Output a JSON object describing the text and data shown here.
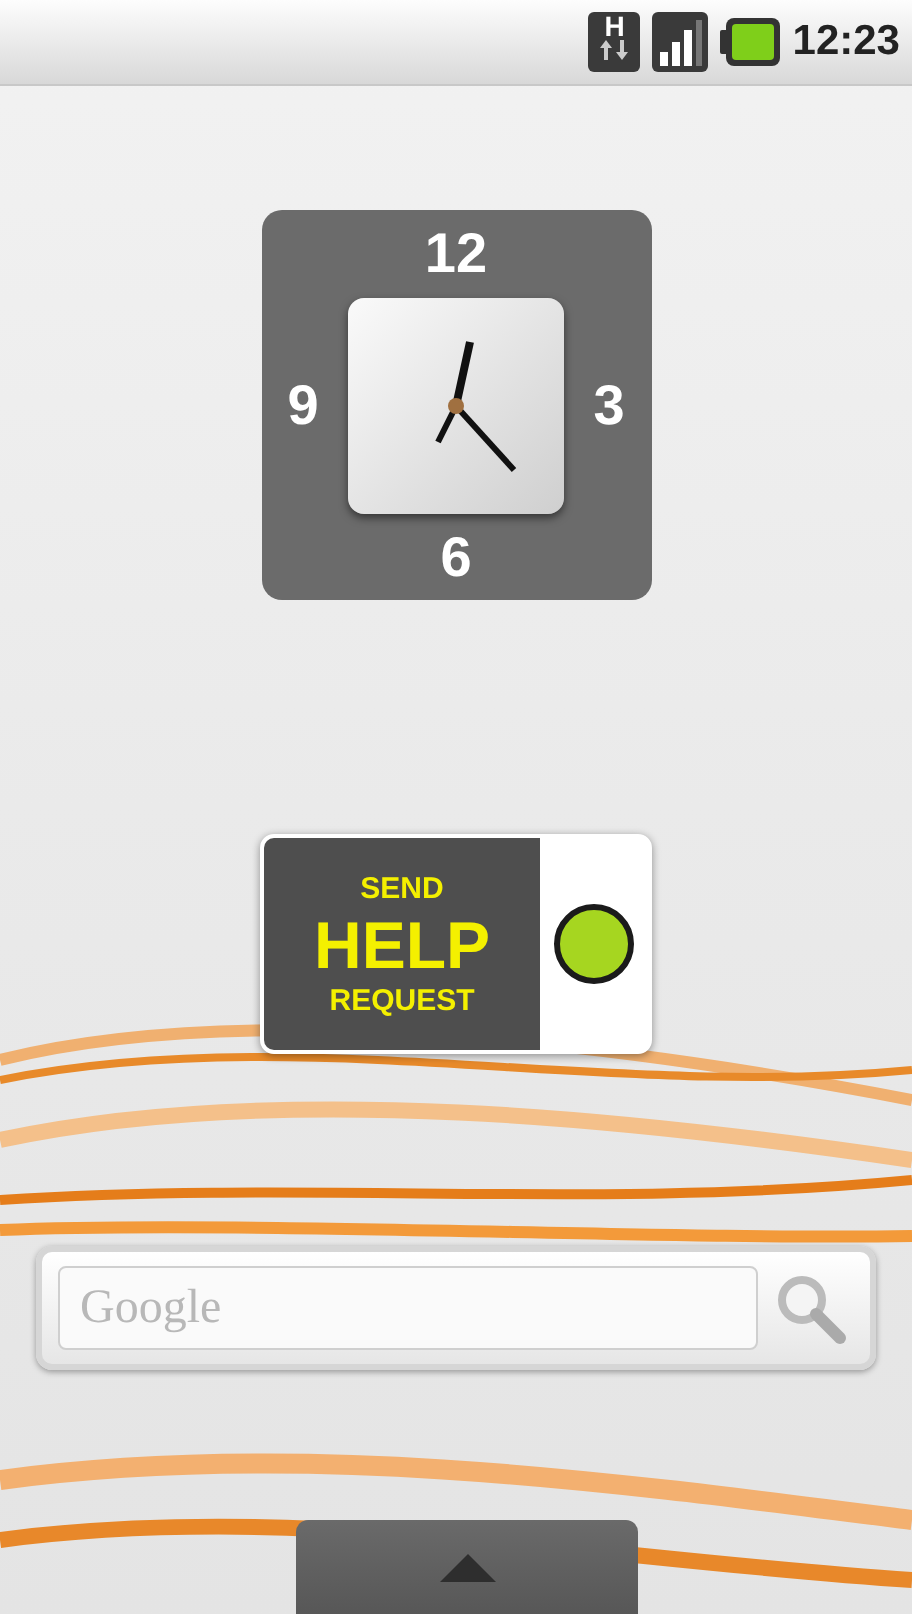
{
  "status_bar": {
    "network": "H",
    "time": "12:23"
  },
  "clock_widget": {
    "numerals": [
      "12",
      "3",
      "6",
      "9"
    ]
  },
  "help_widget": {
    "lines": [
      "SEND",
      "HELP",
      "REQUEST"
    ],
    "on": true
  },
  "search_bar": {
    "placeholder": "Google"
  }
}
